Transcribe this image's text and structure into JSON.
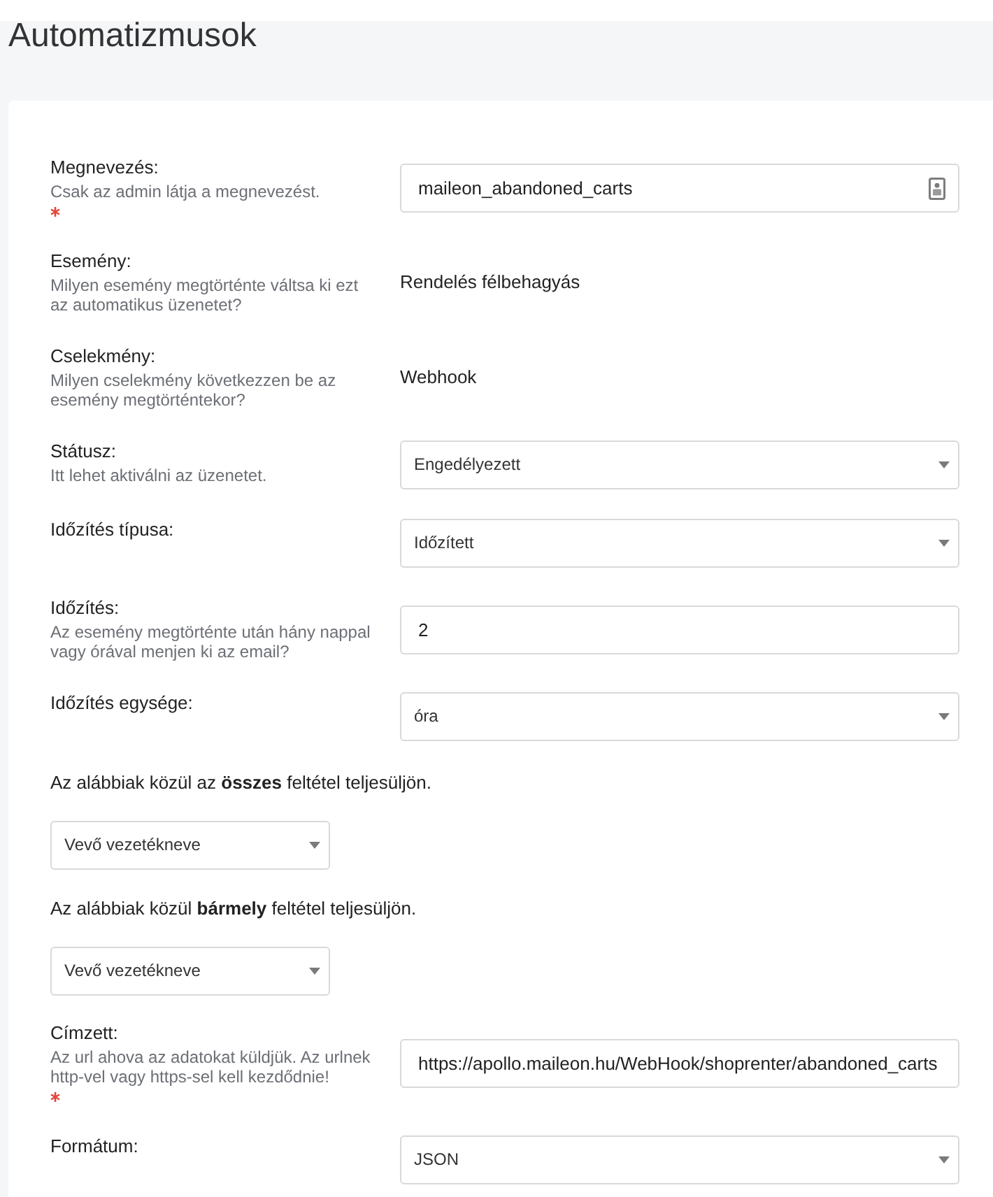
{
  "header": {
    "title": "Automatizmusok"
  },
  "form": {
    "items": [
      {
        "kind": "text",
        "label": "Megnevezés:",
        "hint": "Csak az admin látja a megnevezést.",
        "required": true,
        "value": "maileon_abandoned_carts",
        "has_icon": true
      },
      {
        "kind": "static",
        "label": "Esemény:",
        "hint": "Milyen esemény megtörténte váltsa ki ezt az automatikus üzenetet?",
        "required": false,
        "value": "Rendelés félbehagyás"
      },
      {
        "kind": "static",
        "label": "Cselekmény:",
        "hint": "Milyen cselekmény következzen be az esemény megtörténtekor?",
        "required": false,
        "value": "Webhook"
      },
      {
        "kind": "select",
        "label": "Státusz:",
        "hint": "Itt lehet aktiválni az üzenetet.",
        "required": false,
        "value": "Engedélyezett"
      },
      {
        "kind": "select",
        "label": "Időzítés típusa:",
        "required": false,
        "value": "Időzített"
      },
      {
        "kind": "text",
        "label": "Időzítés:",
        "hint": "Az esemény megtörténte után hány nappal vagy órával menjen ki az email?",
        "required": false,
        "value": "2",
        "has_icon": false
      },
      {
        "kind": "select",
        "label": "Időzítés egysége:",
        "required": false,
        "value": "óra"
      },
      {
        "kind": "condition",
        "text": "Az alábbiak közül az **összes** feltétel teljesüljön.",
        "value": "Vevő vezetékneve"
      },
      {
        "kind": "condition",
        "text": "Az alábbiak közül **bármely** feltétel teljesüljön.",
        "value": "Vevő vezetékneve"
      },
      {
        "kind": "text",
        "label": "Címzett:",
        "hint": "Az url ahova az adatokat küldjük. Az urlnek http-vel vagy https-sel kell kezdődnie!",
        "required": true,
        "value": "https://apollo.maileon.hu/WebHook/shoprenter/abandoned_carts",
        "has_icon": false
      },
      {
        "kind": "select",
        "label": "Formátum:",
        "required": false,
        "value": "JSON"
      }
    ]
  }
}
